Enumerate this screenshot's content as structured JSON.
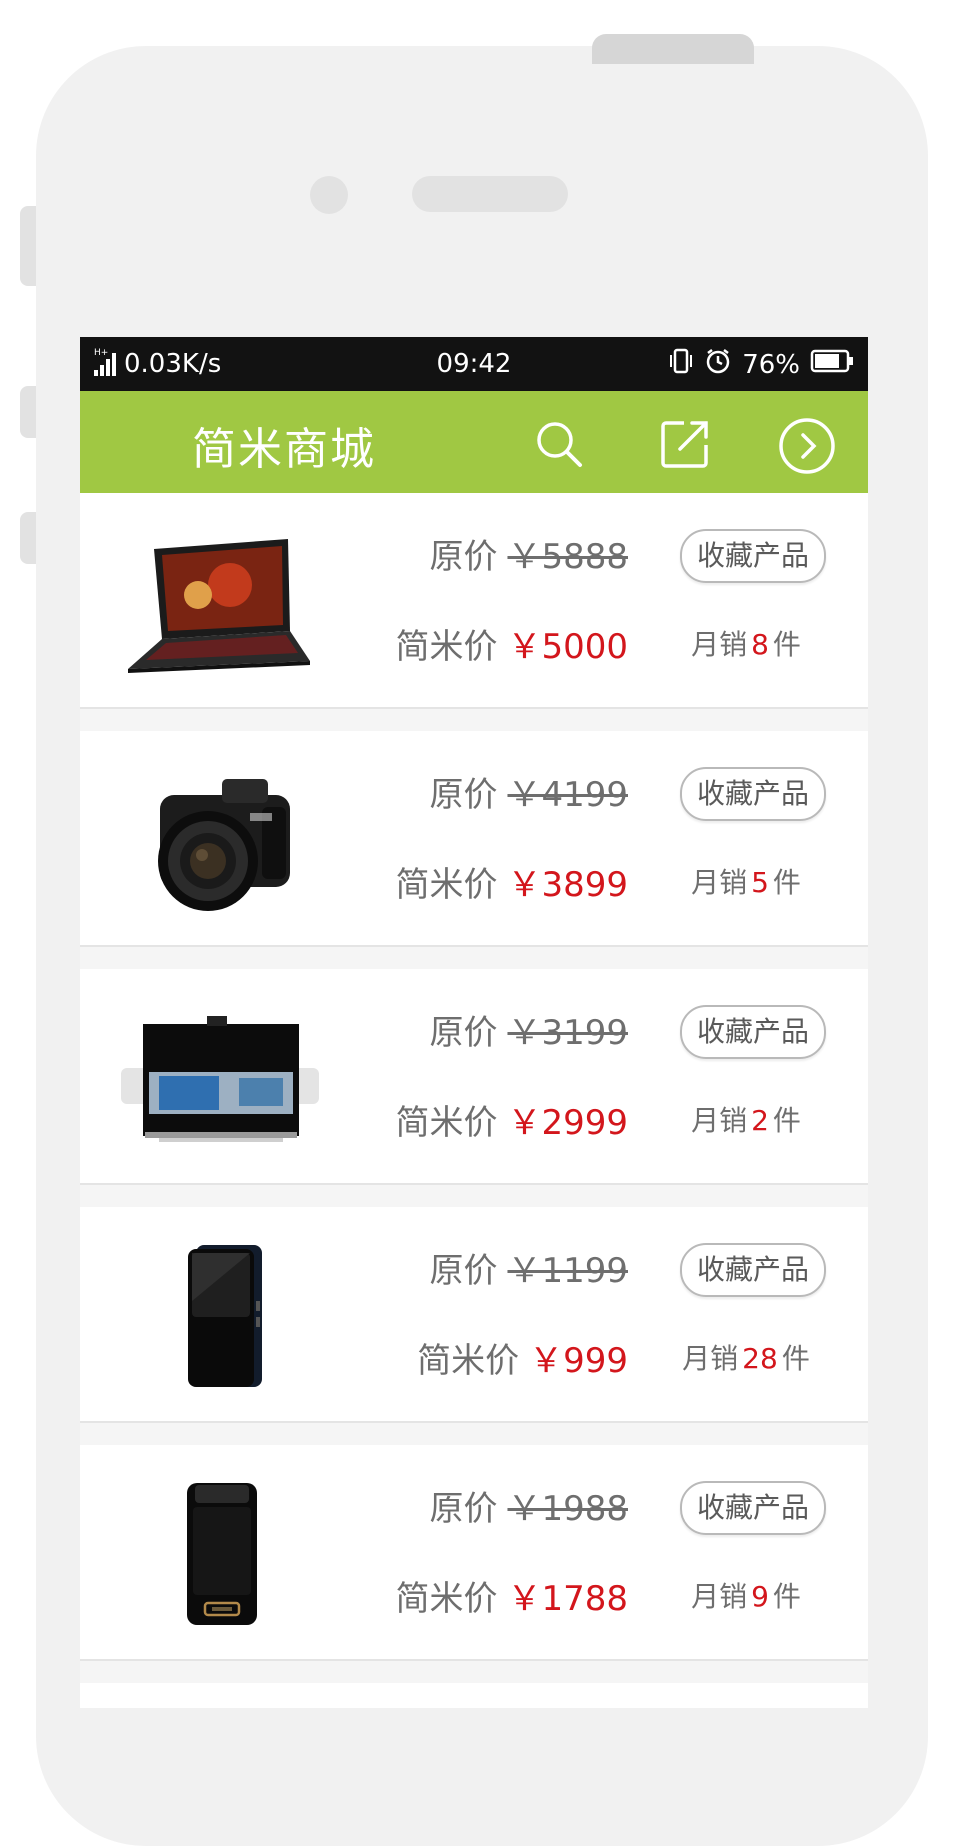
{
  "status_bar": {
    "network": "0.03K/s",
    "signal_label": "H+",
    "time": "09:42",
    "battery": "76%"
  },
  "navbar": {
    "title": "简米商城",
    "icons": [
      "search-icon",
      "share-icon",
      "next-icon"
    ]
  },
  "labels": {
    "original_price": "原价",
    "member_price": "简米价",
    "favorite": "收藏产品",
    "sales_prefix": "月销",
    "sales_suffix": "件"
  },
  "products": [
    {
      "image": "laptop",
      "original_price": "￥5888",
      "price": "￥5000",
      "sales": "8"
    },
    {
      "image": "camera",
      "original_price": "￥4199",
      "price": "￥3899",
      "sales": "5"
    },
    {
      "image": "tv",
      "original_price": "￥3199",
      "price": "￥2999",
      "sales": "2"
    },
    {
      "image": "phone",
      "original_price": "￥1199",
      "price": "￥999",
      "sales": "28"
    },
    {
      "image": "flip-phone",
      "original_price": "￥1988",
      "price": "￥1788",
      "sales": "9"
    }
  ],
  "colors": {
    "accent": "#a0c843",
    "price": "#d3161c",
    "status_bar": "#121212"
  }
}
